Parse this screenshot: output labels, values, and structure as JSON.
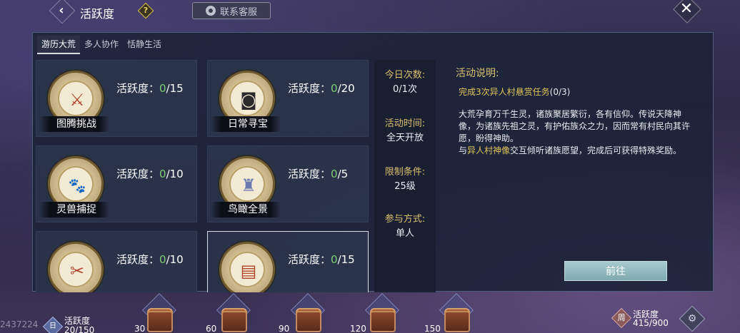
{
  "header": {
    "title": "活跃度",
    "back_icon": "back-chevron-icon",
    "help_glyph": "?",
    "service_label": "联系客服",
    "close_glyph": "✕"
  },
  "tabs": [
    {
      "label": "游历大荒",
      "active": true
    },
    {
      "label": "多人协作",
      "active": false
    },
    {
      "label": "恬静生活",
      "active": false
    }
  ],
  "activity_prefix": "活跃度：",
  "cards": [
    {
      "name": "图腾挑战",
      "current": "0",
      "max": "/15",
      "icon": "axe-icon",
      "glyph": "⚔"
    },
    {
      "name": "日常寻宝",
      "current": "0",
      "max": "/20",
      "icon": "coin-icon",
      "glyph": "◙"
    },
    {
      "name": "灵兽捕捉",
      "current": "0",
      "max": "/10",
      "icon": "beast-icon",
      "glyph": "🐾"
    },
    {
      "name": "鸟瞰全景",
      "current": "0",
      "max": "/5",
      "icon": "tower-icon",
      "glyph": "♜"
    },
    {
      "name": "",
      "current": "0",
      "max": "/10",
      "icon": "tools-icon",
      "glyph": "✂"
    },
    {
      "name": "",
      "current": "0",
      "max": "/15",
      "icon": "calendar-icon",
      "glyph": "▤"
    }
  ],
  "info": {
    "today_count_label": "今日次数:",
    "today_count_value": "0/1次",
    "time_label": "活动时间:",
    "time_value": "全天开放",
    "limit_label": "限制条件:",
    "limit_value": "25级",
    "mode_label": "参与方式:",
    "mode_value": "单人"
  },
  "description": {
    "title": "活动说明:",
    "task": "完成3次异人村悬赏任务",
    "task_count": "(0/3)",
    "text_1": "大荒孕育万千生灵，诸族聚居繁衍，各有信仰。传说天降神像，为诸族先祖之灵，有护佑族众之力，因而常有村民向其许愿，盼得神助。",
    "text_2_pre": "与",
    "text_2_hl": "异人村神像",
    "text_2_post": "交互倾听诸族愿望，完成后可获得特殊奖励。",
    "go_label": "前往"
  },
  "bottom": {
    "uid": "2437224",
    "day_icon_glyph": "日",
    "day_label": "活跃度",
    "day_value": "20/150",
    "chests": [
      "30",
      "60",
      "90",
      "120",
      "150"
    ],
    "week_icon_glyph": "周",
    "week_label": "活跃度",
    "week_value": "415/900",
    "week_reward_glyph": "⚙"
  }
}
